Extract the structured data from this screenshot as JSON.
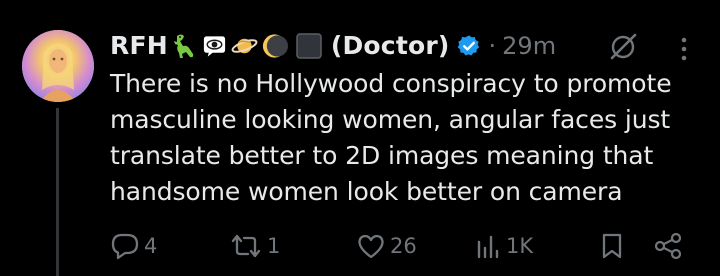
{
  "tweet": {
    "display_name": "RFH",
    "name_suffix": "(Doctor)",
    "separator": "·",
    "timestamp": "29m",
    "emojis": [
      "lizard-emoji",
      "eye-in-speech-bubble-emoji",
      "ringed-planet-emoji",
      "new-moon-emoji",
      "black-square-emoji"
    ],
    "verified_color": "#1d9bf0",
    "text_lines": [
      "There is no Hollywood conspiracy to promote",
      "masculine looking women, angular faces just",
      "translate better to 2D images meaning that",
      "handsome women look better on camera"
    ],
    "actions": {
      "replies": "4",
      "reposts": "1",
      "likes": "26",
      "views": "1K"
    }
  },
  "colors": {
    "background": "#000000",
    "primary_text": "#e7e9ea",
    "secondary_text": "#71767b",
    "accent": "#1d9bf0",
    "thread_line": "#333639"
  }
}
